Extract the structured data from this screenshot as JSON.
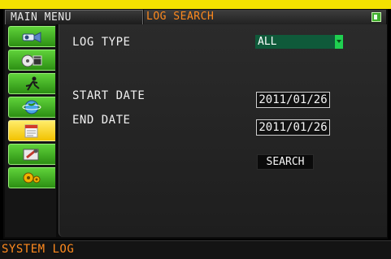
{
  "menu": {
    "title": "MAIN MENU"
  },
  "window": {
    "title": "LOG SEARCH"
  },
  "sidebar": {
    "items": [
      {
        "name": "camera-icon"
      },
      {
        "name": "record-playback-icon"
      },
      {
        "name": "running-figure-icon"
      },
      {
        "name": "network-globe-icon"
      },
      {
        "name": "log-calendar-icon",
        "active": true
      },
      {
        "name": "tools-icon"
      },
      {
        "name": "advanced-settings-icon"
      }
    ]
  },
  "form": {
    "log_type_label": "LOG TYPE",
    "log_type_value": "ALL",
    "start_date_label": "START DATE",
    "start_date_value": "2011/01/26",
    "end_date_label": "END DATE",
    "end_date_value": "2011/01/26",
    "search_label": "SEARCH"
  },
  "status": {
    "text": "SYSTEM LOG"
  },
  "colors": {
    "accent_orange": "#ff8a1e",
    "top_bar_yellow": "#f3e100",
    "sidebar_green": "#4fc22a",
    "active_item_yellow": "#f6d400",
    "dropdown_green": "#0f5a3a"
  }
}
